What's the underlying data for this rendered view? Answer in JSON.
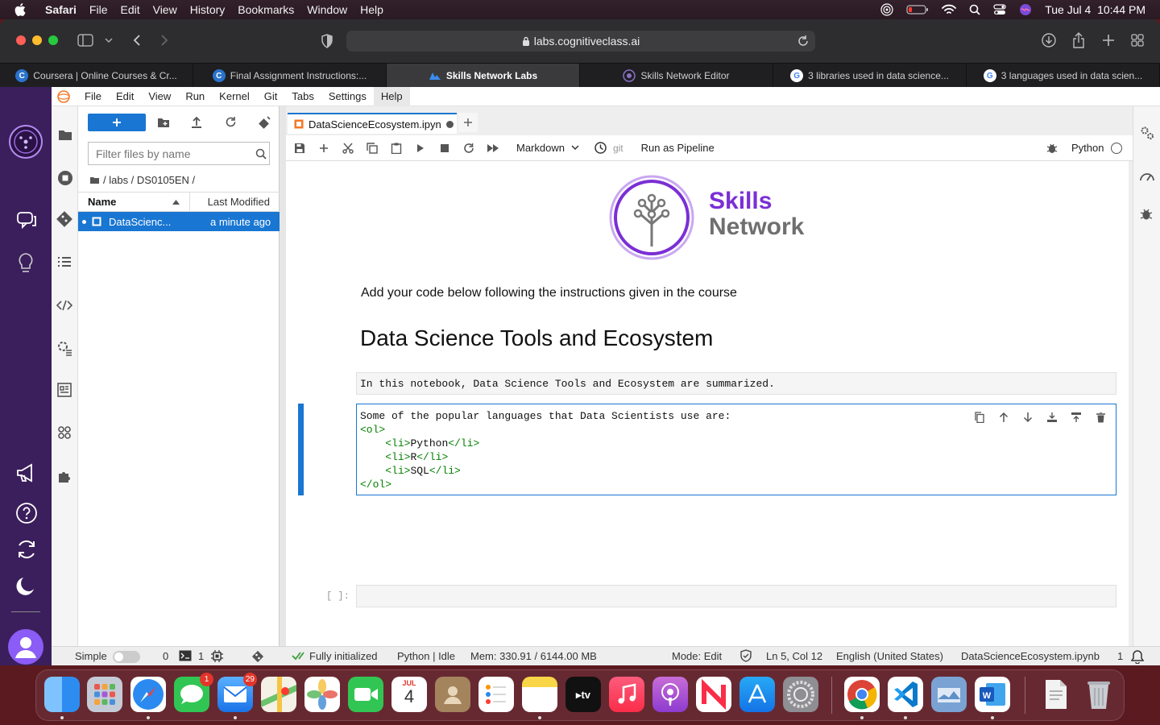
{
  "menubar": {
    "app": "Safari",
    "items": [
      "File",
      "Edit",
      "View",
      "History",
      "Bookmarks",
      "Window",
      "Help"
    ],
    "clock": "Tue Jul 4  10:44 PM"
  },
  "safari": {
    "address": "labs.cognitiveclass.ai",
    "tabs": [
      {
        "title": "Coursera | Online Courses & Cr...",
        "fav_color": "#2a73cc",
        "fav_letter": "C"
      },
      {
        "title": "Final Assignment Instructions:...",
        "fav_color": "#2a73cc",
        "fav_letter": "C"
      },
      {
        "title": "Skills Network Labs",
        "fav_color": "#1e5fbf",
        "fav_letter": ""
      },
      {
        "title": "Skills Network Editor",
        "fav_color": "#6b4e9b",
        "fav_letter": ""
      },
      {
        "title": "3 libraries used in data science...",
        "fav_color": "#ffffff",
        "fav_letter": "G"
      },
      {
        "title": "3 languages used in data scien...",
        "fav_color": "#ffffff",
        "fav_letter": "G"
      }
    ]
  },
  "jupyter": {
    "menu": [
      "File",
      "Edit",
      "View",
      "Run",
      "Kernel",
      "Git",
      "Tabs",
      "Settings",
      "Help"
    ],
    "filter_placeholder": "Filter files by name",
    "breadcrumb": "/ labs / DS0105EN /",
    "columns": {
      "name": "Name",
      "modified": "Last Modified"
    },
    "files": [
      {
        "name": "DataScienc...",
        "modified": "a minute ago"
      }
    ],
    "notebook_tab": "DataScienceEcosystem.ipyn",
    "cell_type": "Markdown",
    "git_label": "git",
    "pipeline_label": "Run as Pipeline",
    "kernel": "Python",
    "logo": {
      "line1": "Skills",
      "line2": "Network"
    },
    "instructions": "Add your code below following the instructions given in the course",
    "heading": "Data Science Tools and Ecosystem",
    "cell1_text": "In this notebook, Data Science Tools and Ecosystem are summarized.",
    "cell2": {
      "line1": "Some of the popular languages that Data Scientists use are:",
      "ol_open": "<ol>",
      "li_open": "<li>",
      "li_close": "</li>",
      "items": [
        "Python",
        "R",
        "SQL"
      ],
      "ol_close": "</ol>"
    },
    "prompt_empty": "[ ]:",
    "status": {
      "mode_label": "Simple",
      "terminals": "0",
      "kernels": "1",
      "init": "Fully initialized",
      "kernel_state": "Python | Idle",
      "mem": "Mem: 330.91 / 6144.00 MB",
      "edit_mode": "Mode: Edit",
      "cursor": "Ln 5, Col 12",
      "language": "English (United States)",
      "filename": "DataScienceEcosystem.ipynb",
      "notifications": "1"
    }
  },
  "dock": {
    "badges": {
      "messages": "1",
      "mail": "29"
    },
    "calendar_month": "JUL",
    "calendar_day": "4"
  },
  "colors": {
    "accent": "#1976d2",
    "purple": "#7b2fd6",
    "nav": "#3b1f5c"
  }
}
